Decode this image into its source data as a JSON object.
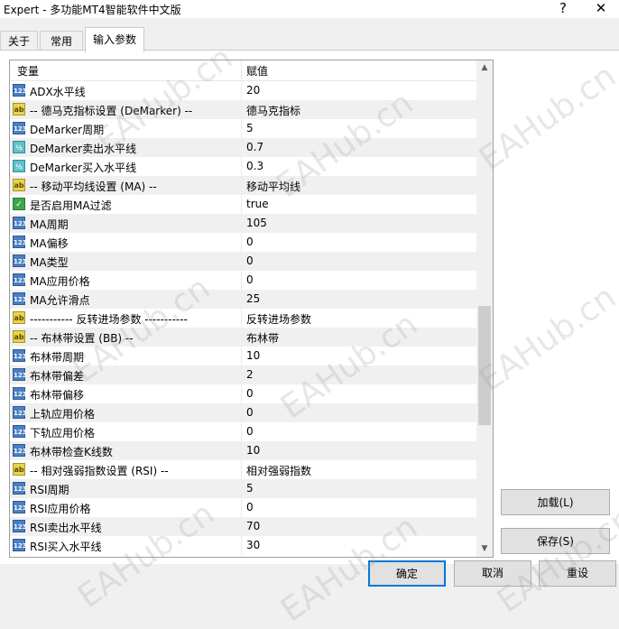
{
  "window": {
    "title": "Expert - 多功能MT4智能软件中文版",
    "help_glyph": "?",
    "close_glyph": "✕"
  },
  "tabs": [
    {
      "label": "关于",
      "active": false
    },
    {
      "label": "常用",
      "active": false
    },
    {
      "label": "输入参数",
      "active": true
    }
  ],
  "table": {
    "col_variable": "变量",
    "col_value": "赋值",
    "rows": [
      {
        "type": "int",
        "name": "ADX水平线",
        "value": "20"
      },
      {
        "type": "string",
        "name": "-- 德马克指标设置 (DeMarker) --",
        "value": "德马克指标"
      },
      {
        "type": "int",
        "name": "DeMarker周期",
        "value": "5"
      },
      {
        "type": "double",
        "name": "DeMarker卖出水平线",
        "value": "0.7"
      },
      {
        "type": "double",
        "name": "DeMarker买入水平线",
        "value": "0.3"
      },
      {
        "type": "string",
        "name": "-- 移动平均线设置 (MA) --",
        "value": "移动平均线"
      },
      {
        "type": "bool",
        "name": "是否启用MA过滤",
        "value": "true"
      },
      {
        "type": "int",
        "name": "MA周期",
        "value": "105"
      },
      {
        "type": "int",
        "name": "MA偏移",
        "value": "0"
      },
      {
        "type": "int",
        "name": "MA类型",
        "value": "0"
      },
      {
        "type": "int",
        "name": "MA应用价格",
        "value": "0"
      },
      {
        "type": "int",
        "name": "MA允许滑点",
        "value": "25"
      },
      {
        "type": "string",
        "name": "----------- 反转进场参数 -----------",
        "value": "反转进场参数"
      },
      {
        "type": "string",
        "name": "-- 布林带设置 (BB) --",
        "value": "布林带"
      },
      {
        "type": "int",
        "name": "布林带周期",
        "value": "10"
      },
      {
        "type": "int",
        "name": "布林带偏差",
        "value": "2"
      },
      {
        "type": "int",
        "name": "布林带偏移",
        "value": "0"
      },
      {
        "type": "int",
        "name": "上轨应用价格",
        "value": "0"
      },
      {
        "type": "int",
        "name": "下轨应用价格",
        "value": "0"
      },
      {
        "type": "int",
        "name": "布林带检查K线数",
        "value": "10"
      },
      {
        "type": "string",
        "name": "-- 相对强弱指数设置 (RSI) --",
        "value": "相对强弱指数"
      },
      {
        "type": "int",
        "name": "RSI周期",
        "value": "5"
      },
      {
        "type": "int",
        "name": "RSI应用价格",
        "value": "0"
      },
      {
        "type": "int",
        "name": "RSI卖出水平线",
        "value": "70"
      },
      {
        "type": "int",
        "name": "RSI买入水平线",
        "value": "30"
      }
    ]
  },
  "icons": {
    "int": {
      "name": "integer-type-icon",
      "glyph": "123"
    },
    "string": {
      "name": "string-type-icon",
      "glyph": "ab"
    },
    "double": {
      "name": "double-type-icon",
      "glyph": "½"
    },
    "bool": {
      "name": "bool-type-icon",
      "glyph": "✓"
    }
  },
  "scrollbar": {
    "up_glyph": "▲",
    "down_glyph": "▼"
  },
  "buttons": {
    "load": "加载(L)",
    "save": "保存(S)",
    "ok": "确定",
    "cancel": "取消",
    "reset": "重设"
  },
  "watermark": "EAHub.cn",
  "colors": {
    "default_button_border": "#0078d7",
    "row_alt": "#f0f0f0"
  }
}
